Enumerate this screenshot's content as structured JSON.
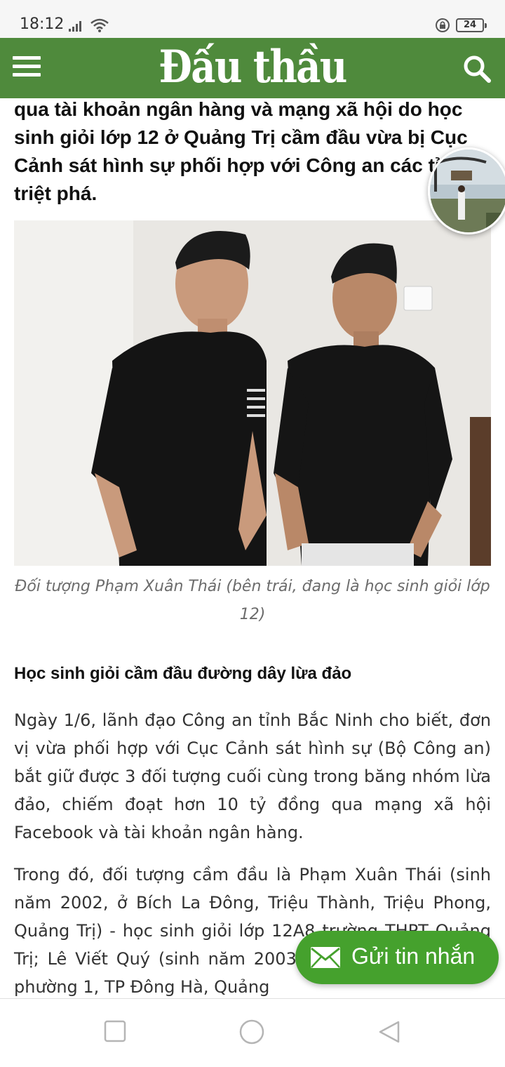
{
  "status_bar": {
    "time": "18:12",
    "battery": "24",
    "icons": [
      "signal-icon",
      "wifi-icon",
      "lock-rotation-icon",
      "battery-icon"
    ]
  },
  "header": {
    "logo": "Đấu thầu",
    "menu_icon": "hamburger-menu-icon",
    "search_icon": "search-icon",
    "background_color": "#4f8a3c"
  },
  "article": {
    "sapo": "qua tài khoản ngân hàng và mạng xã hội do học sinh giỏi lớp 12 ở Quảng Trị cầm đầu vừa bị Cục Cảnh sát hình sự phối hợp với Công an các tỉnh triệt phá.",
    "photo_caption": "Đối tượng Phạm Xuân Thái (bên trái, đang là học sinh giỏi lớp 12)",
    "subheading": "Học sinh giỏi cầm đầu đường dây lừa đảo",
    "paragraph_1": "Ngày 1/6, lãnh đạo Công an tỉnh Bắc Ninh cho biết, đơn vị vừa phối hợp với Cục Cảnh sát hình sự (Bộ Công an) bắt giữ được 3 đối tượng cuối cùng trong băng nhóm lừa đảo, chiếm đoạt hơn 10 tỷ đồng qua mạng xã hội Facebook và tài khoản ngân hàng.",
    "paragraph_2": "Trong đó, đối tượng cầm đầu là Phạm Xuân Thái (sinh năm 2002, ở Bích La Đông, Triệu Thành, Triệu Phong, Quảng Trị) - học sinh giỏi lớp 12A8 trường THPT Quảng Trị; Lê Viết Quý (sinh năm 2003, ở Nguyễn Trãi, KP 8, phường 1, TP Đông Hà, Quảng"
  },
  "floating_widget": {
    "icon": "video-thumbnail-icon"
  },
  "message_button": {
    "label": "Gửi tin nhắn",
    "icon": "envelope-icon",
    "color": "#45a12d"
  },
  "nav_bar": {
    "buttons": [
      "recents-square-icon",
      "home-circle-icon",
      "back-triangle-icon"
    ]
  }
}
